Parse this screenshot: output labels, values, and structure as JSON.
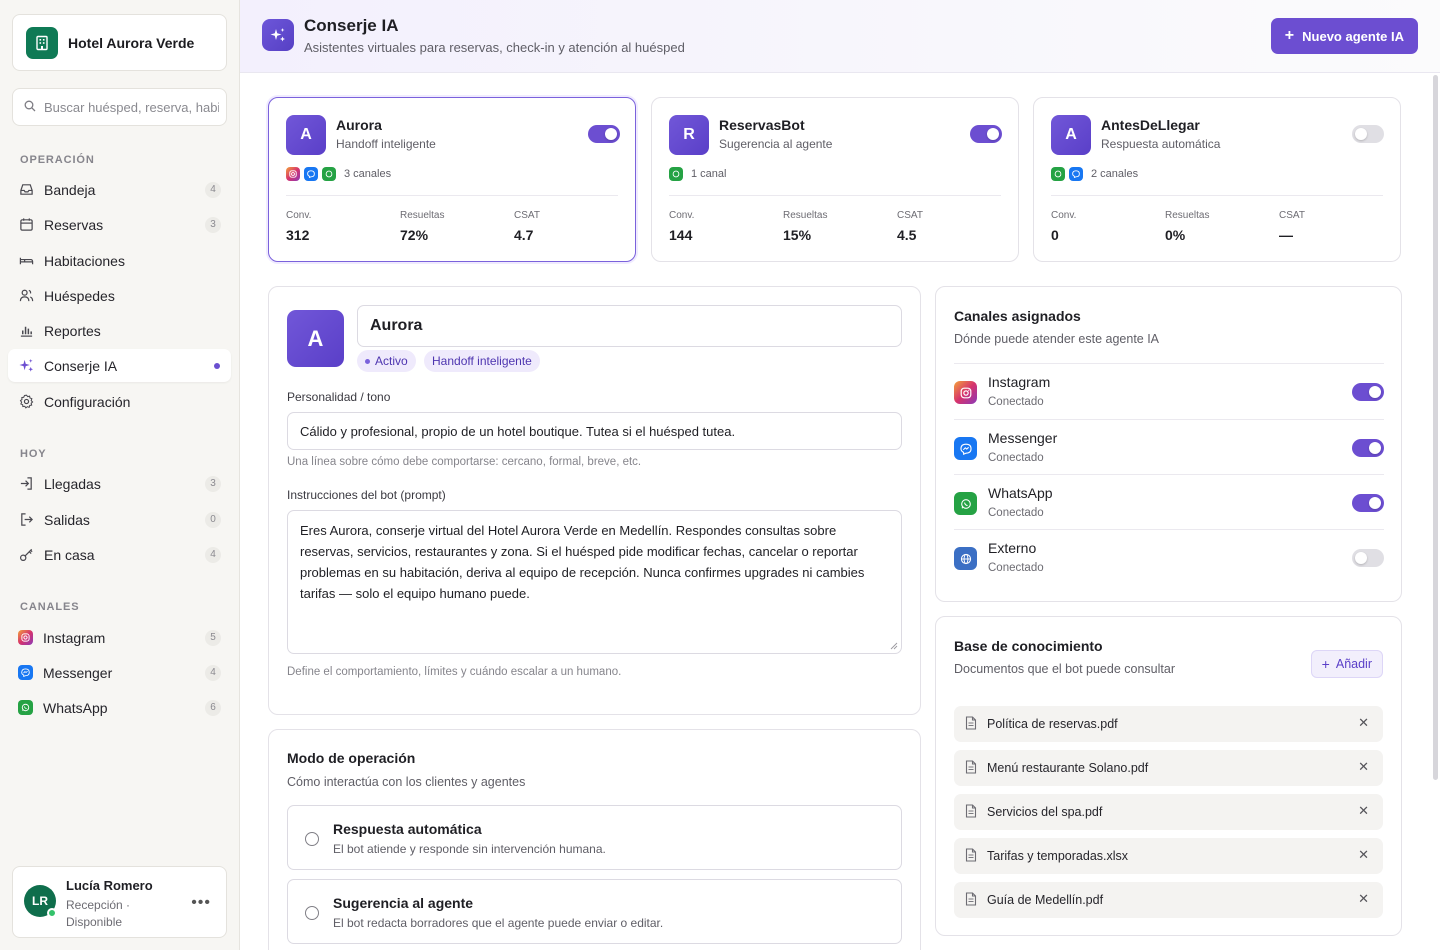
{
  "colors": {
    "accent": "#6c4ed1",
    "brand_green": "#0f7a55",
    "instagram": "#d6336c",
    "messenger": "#1877f2",
    "whatsapp": "#25a244",
    "external": "#3b6fc4"
  },
  "sidebar": {
    "hotel_name": "Hotel Aurora Verde",
    "search_placeholder": "Buscar huésped, reserva, habitación",
    "sections": {
      "operacion": "OPERACIÓN",
      "hoy": "HOY",
      "canales": "CANALES"
    },
    "operacion": [
      {
        "label": "Bandeja",
        "icon": "inbox-icon",
        "count": "4"
      },
      {
        "label": "Reservas",
        "icon": "calendar-icon",
        "count": "3"
      },
      {
        "label": "Habitaciones",
        "icon": "bed-icon",
        "count": ""
      },
      {
        "label": "Huéspedes",
        "icon": "users-icon",
        "count": ""
      },
      {
        "label": "Reportes",
        "icon": "chart-icon",
        "count": ""
      },
      {
        "label": "Conserje IA",
        "icon": "sparkles-icon",
        "count": "",
        "active": true
      },
      {
        "label": "Configuración",
        "icon": "gear-icon",
        "count": ""
      }
    ],
    "hoy": [
      {
        "label": "Llegadas",
        "icon": "login-icon",
        "count": "3"
      },
      {
        "label": "Salidas",
        "icon": "logout-icon",
        "count": "0"
      },
      {
        "label": "En casa",
        "icon": "key-icon",
        "count": "4"
      }
    ],
    "canales": [
      {
        "label": "Instagram",
        "icon": "instagram-icon",
        "count": "5"
      },
      {
        "label": "Messenger",
        "icon": "messenger-icon",
        "count": "4"
      },
      {
        "label": "WhatsApp",
        "icon": "whatsapp-icon",
        "count": "6"
      }
    ],
    "user": {
      "initials": "LR",
      "name": "Lucía Romero",
      "role": "Recepción ·",
      "status": "Disponible"
    }
  },
  "header": {
    "title": "Conserje IA",
    "subtitle": "Asistentes virtuales para reservas, check-in y atención al huésped",
    "new_button": "Nuevo agente IA"
  },
  "agents": [
    {
      "initial": "A",
      "name": "Aurora",
      "mode": "Handoff inteligente",
      "enabled": true,
      "selected": true,
      "channels": [
        "instagram",
        "messenger",
        "whatsapp"
      ],
      "channel_count": "3 canales",
      "stats": [
        {
          "k": "Conv.",
          "v": "312"
        },
        {
          "k": "Resueltas",
          "v": "72%"
        },
        {
          "k": "CSAT",
          "v": "4.7"
        }
      ]
    },
    {
      "initial": "R",
      "name": "ReservasBot",
      "mode": "Sugerencia al agente",
      "enabled": true,
      "selected": false,
      "channels": [
        "whatsapp"
      ],
      "channel_count": "1 canal",
      "stats": [
        {
          "k": "Conv.",
          "v": "144"
        },
        {
          "k": "Resueltas",
          "v": "15%"
        },
        {
          "k": "CSAT",
          "v": "4.5"
        }
      ]
    },
    {
      "initial": "A",
      "name": "AntesDeLlegar",
      "mode": "Respuesta automática",
      "enabled": false,
      "selected": false,
      "channels": [
        "whatsapp",
        "messenger"
      ],
      "channel_count": "2 canales",
      "stats": [
        {
          "k": "Conv.",
          "v": "0"
        },
        {
          "k": "Resueltas",
          "v": "0%"
        },
        {
          "k": "CSAT",
          "v": "—"
        }
      ]
    }
  ],
  "editor": {
    "initial": "A",
    "name": "Aurora",
    "status_pill": "Activo",
    "mode_pill": "Handoff inteligente",
    "personality_label": "Personalidad / tono",
    "personality_value": "Cálido y profesional, propio de un hotel boutique. Tutea si el huésped tutea.",
    "personality_hint": "Una línea sobre cómo debe comportarse: cercano, formal, breve, etc.",
    "prompt_label": "Instrucciones del bot (prompt)",
    "prompt_value": "Eres Aurora, conserje virtual del Hotel Aurora Verde en Medellín. Respondes consultas sobre reservas, servicios, restaurantes y zona. Si el huésped pide modificar fechas, cancelar o reportar problemas en su habitación, deriva al equipo de recepción. Nunca confirmes upgrades ni cambies tarifas — solo el equipo humano puede.",
    "prompt_hint": "Define el comportamiento, límites y cuándo escalar a un humano."
  },
  "operation_mode": {
    "title": "Modo de operación",
    "subtitle": "Cómo interactúa con los clientes y agentes",
    "options": [
      {
        "title": "Respuesta automática",
        "desc": "El bot atiende y responde sin intervención humana."
      },
      {
        "title": "Sugerencia al agente",
        "desc": "El bot redacta borradores que el agente puede enviar o editar."
      }
    ]
  },
  "channels_panel": {
    "title": "Canales asignados",
    "subtitle": "Dónde puede atender este agente IA",
    "items": [
      {
        "name": "Instagram",
        "status": "Conectado",
        "icon": "instagram-icon",
        "enabled": true
      },
      {
        "name": "Messenger",
        "status": "Conectado",
        "icon": "messenger-icon",
        "enabled": true
      },
      {
        "name": "WhatsApp",
        "status": "Conectado",
        "icon": "whatsapp-icon",
        "enabled": true
      },
      {
        "name": "Externo",
        "status": "Conectado",
        "icon": "globe-icon",
        "enabled": false
      }
    ]
  },
  "knowledge": {
    "title": "Base de conocimiento",
    "subtitle": "Documentos que el bot puede consultar",
    "add_button": "Añadir",
    "remove_glyph": "✕",
    "docs": [
      "Política de reservas.pdf",
      "Menú restaurante Solano.pdf",
      "Servicios del spa.pdf",
      "Tarifas y temporadas.xlsx",
      "Guía de Medellín.pdf"
    ]
  }
}
